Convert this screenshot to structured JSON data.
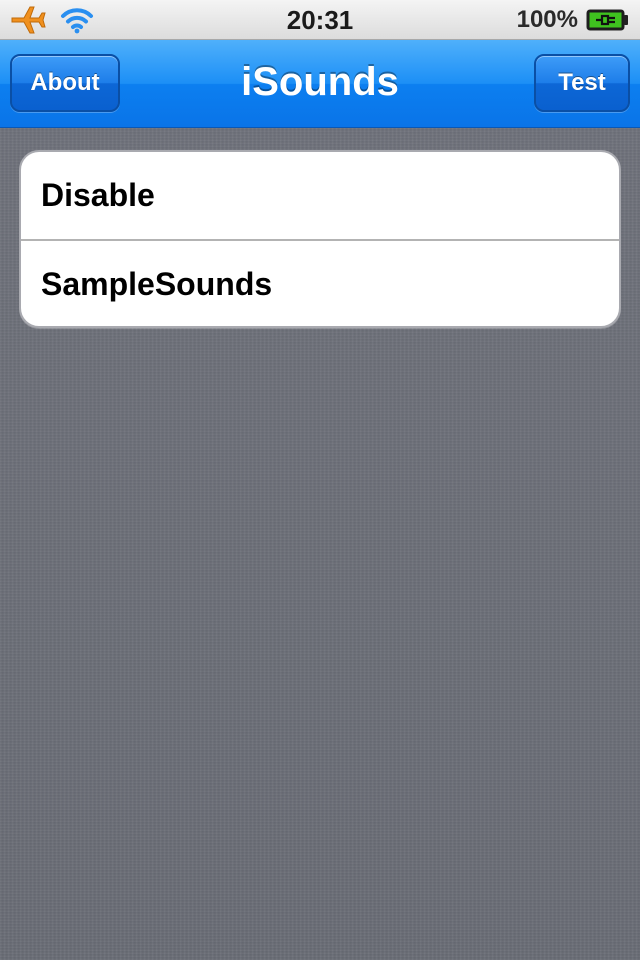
{
  "status_bar": {
    "time": "20:31",
    "battery_percent": "100%",
    "icons": [
      "airplane-icon",
      "wifi-icon",
      "battery-charging-icon"
    ],
    "battery_level": 1.0
  },
  "nav_bar": {
    "title": "iSounds",
    "left_button": "About",
    "right_button": "Test"
  },
  "table": {
    "rows": [
      {
        "label": "Disable"
      },
      {
        "label": "SampleSounds"
      }
    ]
  },
  "colors": {
    "nav_blue": "#1c8ff6",
    "background": "#6d7079",
    "airplane_orange": "#f0901e",
    "wifi_blue": "#2a8ff0",
    "battery_green": "#3fc21f"
  }
}
